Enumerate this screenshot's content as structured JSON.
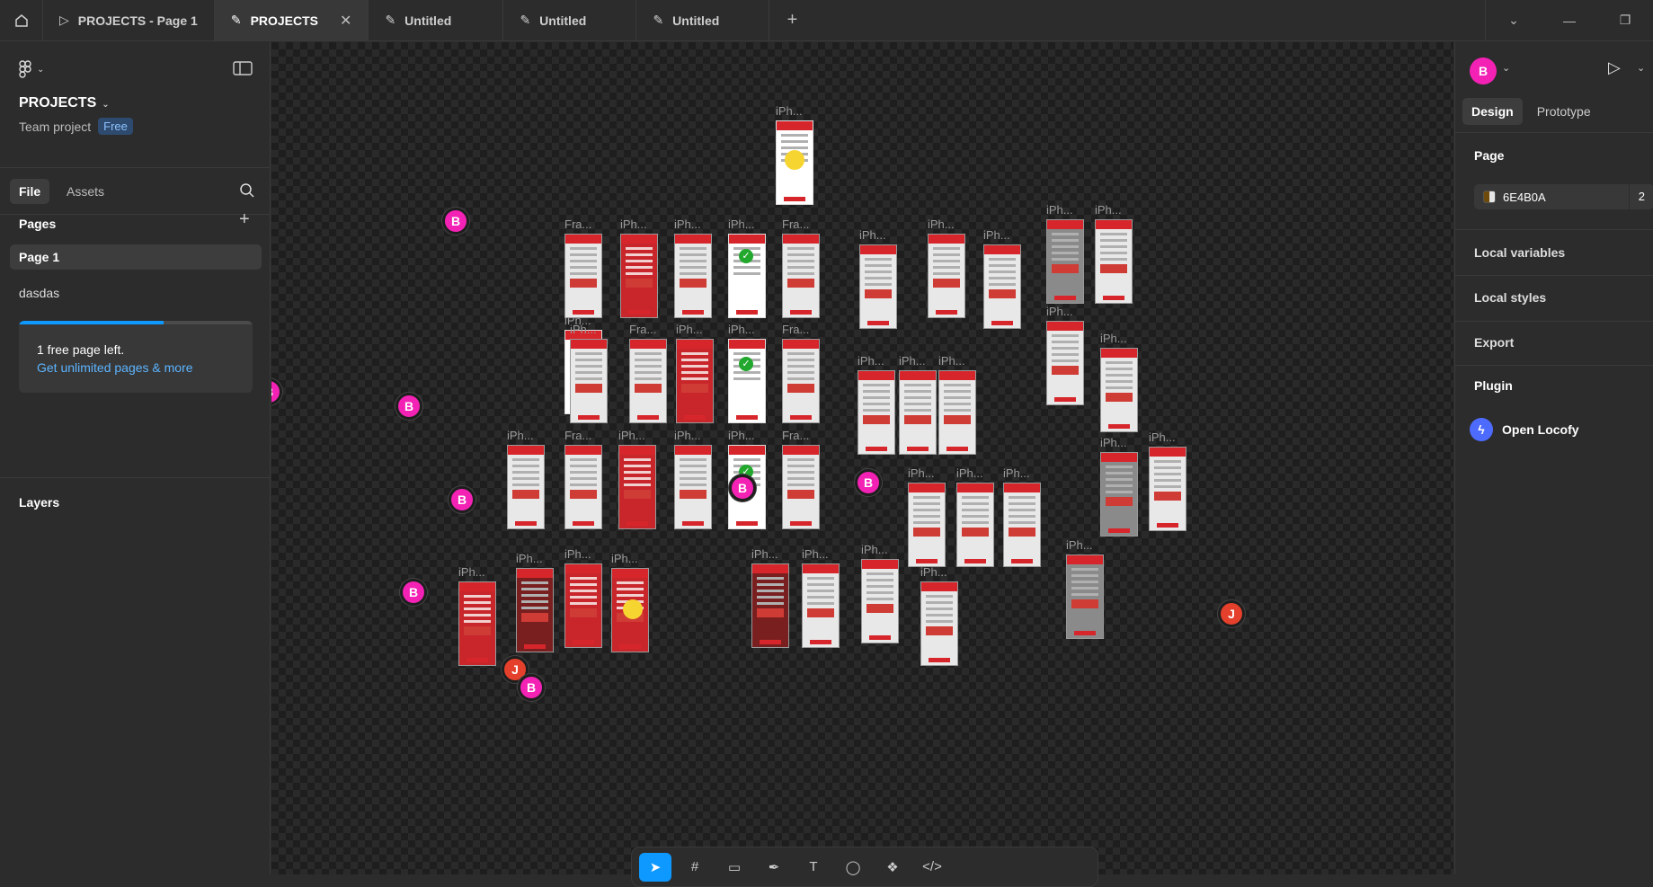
{
  "titlebar": {
    "tabs": [
      {
        "label": "PROJECTS - Page 1",
        "icon": "play-icon"
      },
      {
        "label": "PROJECTS",
        "icon": "pen-icon",
        "active": true
      },
      {
        "label": "Untitled",
        "icon": "pen-icon"
      },
      {
        "label": "Untitled",
        "icon": "pen-icon"
      },
      {
        "label": "Untitled",
        "icon": "pen-icon"
      }
    ]
  },
  "left": {
    "project_name": "PROJECTS",
    "team": "Team project",
    "plan_badge": "Free",
    "file_tab": "File",
    "assets_tab": "Assets",
    "pages_title": "Pages",
    "pages": [
      "Page 1",
      "dasdas"
    ],
    "upgrade_line1": "1 free page left.",
    "upgrade_line2": "Get unlimited pages & more",
    "upgrade_progress": 0.62,
    "layers_title": "Layers"
  },
  "canvas": {
    "labels": {
      "iph": "iPh...",
      "fra": "Fra..."
    },
    "avatars": {
      "b": "B",
      "j": "J"
    }
  },
  "right": {
    "avatar": "B",
    "design_tab": "Design",
    "prototype_tab": "Prototype",
    "page_title": "Page",
    "page_color": "6E4B0A",
    "page_opacity": "2",
    "local_variables": "Local variables",
    "local_styles": "Local styles",
    "export": "Export",
    "plugin_title": "Plugin",
    "plugin_name": "Open Locofy"
  },
  "colors": {
    "accent": "#0d99ff",
    "avatar_pink": "#f322b4",
    "avatar_orange": "#e4402b",
    "frame_red": "#d6262b"
  }
}
